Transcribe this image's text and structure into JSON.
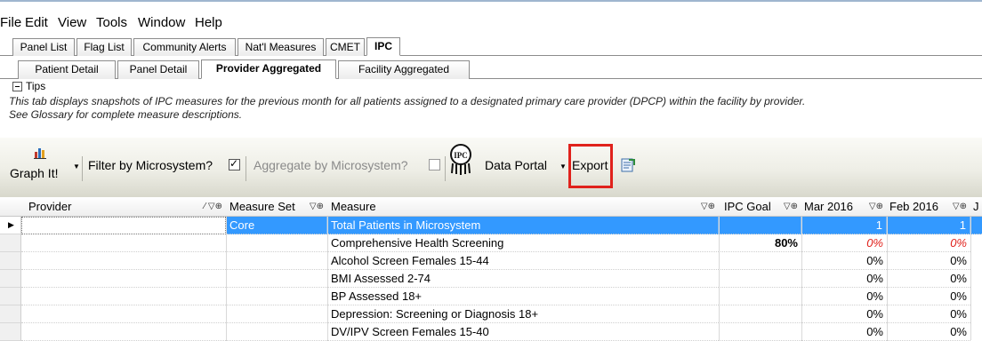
{
  "menu": [
    "File",
    "Edit",
    "View",
    "Tools",
    "Window",
    "Help"
  ],
  "tabs_top": [
    "Panel List",
    "Flag List",
    "Community Alerts",
    "Nat'l Measures",
    "CMET",
    "IPC"
  ],
  "tabs_sub": [
    "Patient Detail",
    "Panel Detail",
    "Provider Aggregated",
    "Facility Aggregated"
  ],
  "tips": {
    "label": "Tips",
    "line1": "This tab displays snapshots of IPC measures for the previous month for all patients assigned to a designated primary care provider (DPCP) within the facility by provider.",
    "line2": "See Glossary for complete measure descriptions."
  },
  "toolbar": {
    "graph": "Graph It!",
    "filter": "Filter by Microsystem?",
    "filter_checked": true,
    "aggregate": "Aggregate by Microsystem?",
    "aggregate_checked": false,
    "logo_text": "IPC",
    "data_portal": "Data Portal",
    "export": "Export",
    "highlight_color": "#e0221c"
  },
  "columns": {
    "provider": "Provider",
    "measure_set": "Measure Set",
    "measure": "Measure",
    "ipc_goal": "IPC Goal",
    "mar": "Mar 2016",
    "feb": "Feb 2016",
    "next": "J"
  },
  "rows": [
    {
      "provider": "",
      "set": "Core",
      "measure": "Total Patients in Microsystem",
      "goal": "",
      "mar": "1",
      "feb": "1"
    },
    {
      "provider": "",
      "set": "",
      "measure": "Comprehensive Health Screening",
      "goal": "80%",
      "mar": "0%",
      "feb": "0%"
    },
    {
      "provider": "",
      "set": "",
      "measure": "Alcohol Screen Females 15-44",
      "goal": "",
      "mar": "0%",
      "feb": "0%"
    },
    {
      "provider": "",
      "set": "",
      "measure": "BMI Assessed 2-74",
      "goal": "",
      "mar": "0%",
      "feb": "0%"
    },
    {
      "provider": "",
      "set": "",
      "measure": "BP Assessed 18+",
      "goal": "",
      "mar": "0%",
      "feb": "0%"
    },
    {
      "provider": "",
      "set": "",
      "measure": "Depression: Screening or Diagnosis 18+",
      "goal": "",
      "mar": "0%",
      "feb": "0%"
    },
    {
      "provider": "",
      "set": "",
      "measure": "DV/IPV Screen Females 15-40",
      "goal": "",
      "mar": "0%",
      "feb": "0%"
    }
  ],
  "colors": {
    "selection": "#3399ff",
    "toolbar": "#e6e6dc"
  },
  "icons": [
    "bar-chart-icon",
    "dropdown-arrow-icon",
    "ipc-logo-icon",
    "export-sheet-icon",
    "filter-pin-icon"
  ]
}
